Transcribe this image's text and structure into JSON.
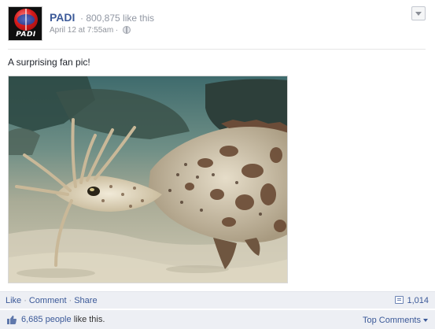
{
  "header": {
    "page_name": "PADI",
    "like_count": "· 800,875 like this",
    "timestamp": "April 12 at 7:55am ·",
    "avatar_text": "PADI"
  },
  "post": {
    "message": "A surprising fan pic!"
  },
  "actions": {
    "like": "Like",
    "comment": "Comment",
    "share": "Share",
    "separator": "·",
    "share_count": "1,014"
  },
  "likes": {
    "count_link": "6,685 people",
    "suffix": "like this.",
    "top_comments": "Top Comments"
  },
  "colors": {
    "link": "#3b5998",
    "bar_bg": "#edeff4",
    "muted": "#9197a3"
  }
}
